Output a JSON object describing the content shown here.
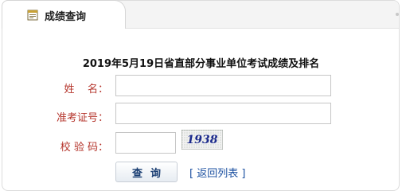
{
  "tab": {
    "label": "成绩查询",
    "icon": "document-icon"
  },
  "form": {
    "title": "2019年5月19日省直部分事业单位考试成绩及排名",
    "fields": [
      {
        "label": "姓    名：",
        "value": "",
        "placeholder": ""
      },
      {
        "label": "准考证号：",
        "value": "",
        "placeholder": ""
      },
      {
        "label": "校 验 码：",
        "value": "",
        "placeholder": ""
      }
    ],
    "captcha_text": "1938",
    "search_label": "查询",
    "back_label": "[ 返回列表 ]"
  },
  "colors": {
    "label": "#b5352c",
    "captcha_text": "#1b2a8c",
    "link": "#1a4fa0",
    "button_text": "#1b3f73"
  }
}
